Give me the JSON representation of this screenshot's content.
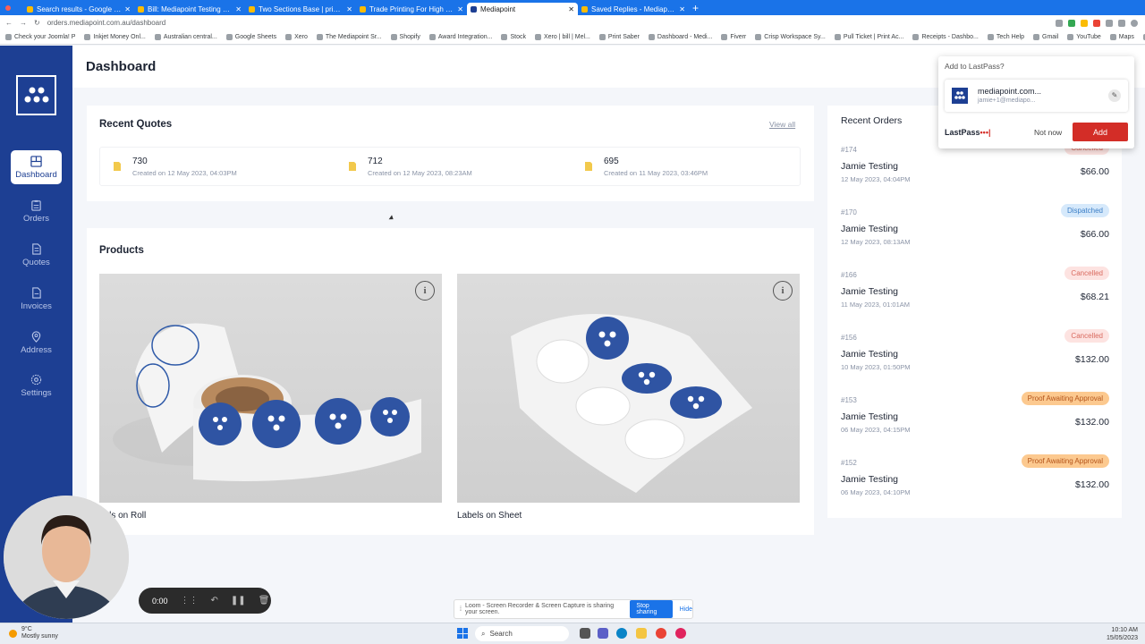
{
  "browser": {
    "tabs": [
      {
        "label": "Search results - Google Drive",
        "active": false
      },
      {
        "label": "Bill: Mediapoint Testing - Media",
        "active": false
      },
      {
        "label": "Two Sections Base | print3D",
        "active": false
      },
      {
        "label": "Trade Printing For High Volume R",
        "active": false
      },
      {
        "label": "Mediapoint",
        "active": true
      },
      {
        "label": "Saved Replies - Mediapoint Trad",
        "active": false
      }
    ],
    "new_tab": "+",
    "url": "orders.mediapoint.com.au/dashboard",
    "bookmarks": [
      "Check your Joomla! P",
      "Inkjet Money Onl...",
      "Australian central...",
      "Google Sheets",
      "Xero",
      "The Mediapoint Sr...",
      "Shopify",
      "Award Integration...",
      "Stock",
      "Xero | bill | Mel...",
      "Print Saber",
      "Dashboard - Medi...",
      "Fiverr",
      "Crisp Workspace Sy...",
      "Pull Ticket | Print Ac...",
      "Receipts - Dashbo...",
      "Tech Help",
      "Gmail",
      "YouTube",
      "Maps",
      "Other bookmarks"
    ]
  },
  "sidebar": {
    "items": [
      {
        "label": "Dashboard",
        "icon": "dashboard-icon",
        "active": true
      },
      {
        "label": "Orders",
        "icon": "clipboard-icon",
        "active": false
      },
      {
        "label": "Quotes",
        "icon": "quote-icon",
        "active": false
      },
      {
        "label": "Invoices",
        "icon": "invoice-icon",
        "active": false
      },
      {
        "label": "Address",
        "icon": "location-pin-icon",
        "active": false
      },
      {
        "label": "Settings",
        "icon": "gear-icon",
        "active": false
      }
    ]
  },
  "header": {
    "title": "Dashboard"
  },
  "recent_quotes": {
    "title": "Recent Quotes",
    "view_all": "View all",
    "items": [
      {
        "number": "730",
        "created": "Created on 12 May 2023, 04:03PM"
      },
      {
        "number": "712",
        "created": "Created on 12 May 2023, 08:23AM"
      },
      {
        "number": "695",
        "created": "Created on 11 May 2023, 03:46PM"
      }
    ]
  },
  "products": {
    "title": "Products",
    "items": [
      {
        "label": "Labels on Roll",
        "visible_label": "bels on Roll"
      },
      {
        "label": "Labels on Sheet"
      }
    ]
  },
  "recent_orders": {
    "title": "Recent Orders",
    "items": [
      {
        "number": "#174",
        "name": "Jamie Testing",
        "date": "12 May 2023, 04:04PM",
        "price": "$66.00",
        "status": "Cancelled",
        "status_type": "cancelled"
      },
      {
        "number": "#170",
        "name": "Jamie Testing",
        "date": "12 May 2023, 08:13AM",
        "price": "$66.00",
        "status": "Dispatched",
        "status_type": "dispatched"
      },
      {
        "number": "#166",
        "name": "Jamie Testing",
        "date": "11 May 2023, 01:01AM",
        "price": "$68.21",
        "status": "Cancelled",
        "status_type": "cancelled"
      },
      {
        "number": "#156",
        "name": "Jamie Testing",
        "date": "10 May 2023, 01:50PM",
        "price": "$132.00",
        "status": "Cancelled",
        "status_type": "cancelled"
      },
      {
        "number": "#153",
        "name": "Jamie Testing",
        "date": "06 May 2023, 04:15PM",
        "price": "$132.00",
        "status": "Proof Awaiting Approval",
        "status_type": "proof"
      },
      {
        "number": "#152",
        "name": "Jamie Testing",
        "date": "06 May 2023, 04:10PM",
        "price": "$132.00",
        "status": "Proof Awaiting Approval",
        "status_type": "proof"
      }
    ]
  },
  "lastpass": {
    "title": "Add to LastPass?",
    "site": "mediapoint.com...",
    "user": "jamie+1@mediapo...",
    "brand": "LastPass",
    "brand_dots": "•••|",
    "not_now": "Not now",
    "add": "Add"
  },
  "recorder": {
    "time": "0:00"
  },
  "share_bar": {
    "text": "Loom - Screen Recorder & Screen Capture is sharing your screen.",
    "stop": "Stop sharing",
    "hide": "Hide"
  },
  "taskbar": {
    "weather_temp": "9°C",
    "weather_text": "Mostly sunny",
    "search": "Search",
    "time": "10:10 AM",
    "date": "15/05/2023"
  },
  "colors": {
    "brand": "#1d3f93",
    "accent_red": "#d32d27",
    "chrome_blue": "#1a73e8"
  }
}
